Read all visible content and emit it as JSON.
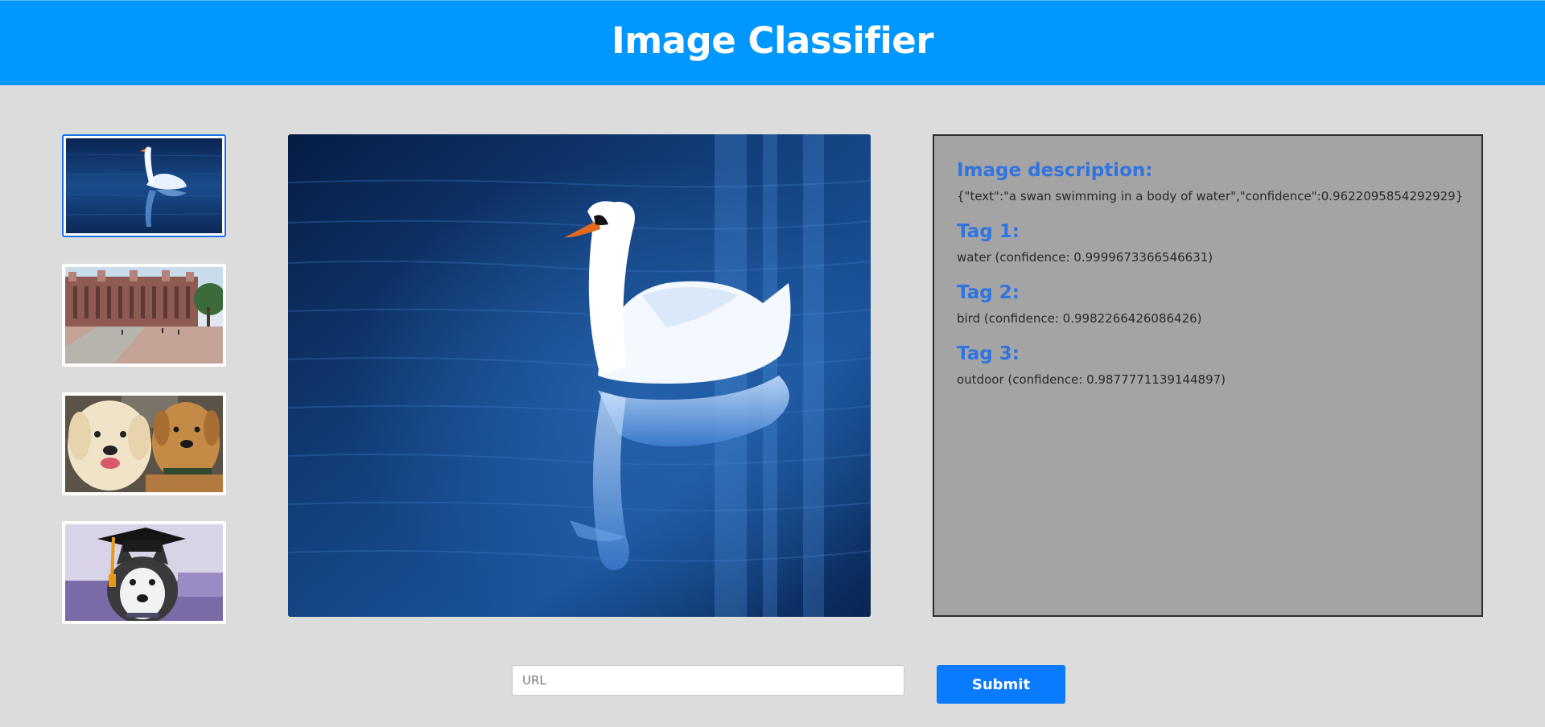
{
  "header": {
    "title": "Image Classifier"
  },
  "gallery": {
    "selected_index": 0,
    "thumbnails": [
      {
        "icon": "swan-photo"
      },
      {
        "icon": "campus-building-photo"
      },
      {
        "icon": "two-dogs-photo"
      },
      {
        "icon": "husky-graduation-photo"
      }
    ]
  },
  "results": {
    "description_heading": "Image description:",
    "description_value": "{\"text\":\"a swan swimming in a body of water\",\"confidence\":0.9622095854292929}",
    "tags": [
      {
        "heading": "Tag 1:",
        "value": "water (confidence: 0.9999673366546631)"
      },
      {
        "heading": "Tag 2:",
        "value": "bird (confidence: 0.9982266426086426)"
      },
      {
        "heading": "Tag 3:",
        "value": "outdoor (confidence: 0.9877771139144897)"
      }
    ]
  },
  "form": {
    "url_placeholder": "URL",
    "url_value": "",
    "submit_label": "Submit"
  },
  "colors": {
    "header_bg": "#0097ff",
    "accent_heading": "#2f74e0",
    "submit_bg": "#0a7bff",
    "panel_bg": "#a4a4a4",
    "page_bg": "#dcdcdc"
  }
}
